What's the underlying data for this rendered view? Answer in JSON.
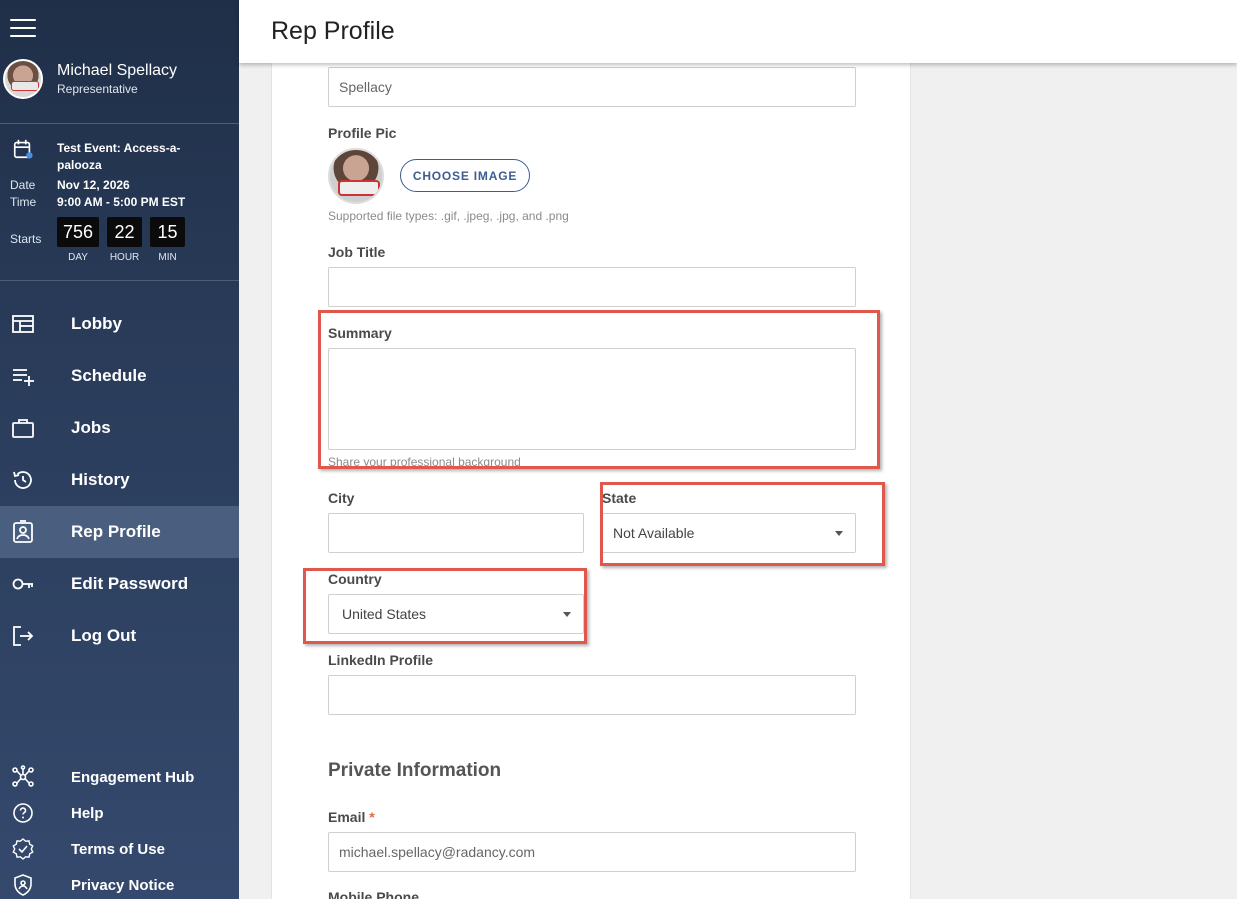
{
  "user": {
    "name": "Michael Spellacy",
    "role": "Representative"
  },
  "event": {
    "title": "Test Event: Access-a-palooza",
    "date_label": "Date",
    "date_value": "Nov 12, 2026",
    "time_label": "Time",
    "time_value": "9:00 AM - 5:00 PM EST",
    "starts_label": "Starts",
    "countdown": [
      {
        "value": "756",
        "unit": "DAY"
      },
      {
        "value": "22",
        "unit": "HOUR"
      },
      {
        "value": "15",
        "unit": "MIN"
      }
    ]
  },
  "nav": {
    "items": [
      {
        "label": "Lobby",
        "icon": "lobby-icon"
      },
      {
        "label": "Schedule",
        "icon": "schedule-icon"
      },
      {
        "label": "Jobs",
        "icon": "briefcase-icon"
      },
      {
        "label": "History",
        "icon": "history-icon"
      },
      {
        "label": "Rep Profile",
        "icon": "profile-icon",
        "active": true
      },
      {
        "label": "Edit Password",
        "icon": "key-icon"
      },
      {
        "label": "Log Out",
        "icon": "logout-icon"
      }
    ],
    "bottom": [
      {
        "label": "Engagement Hub",
        "icon": "hub-icon"
      },
      {
        "label": "Help",
        "icon": "help-icon"
      },
      {
        "label": "Terms of Use",
        "icon": "terms-icon"
      },
      {
        "label": "Privacy Notice",
        "icon": "privacy-icon"
      }
    ]
  },
  "header": {
    "title": "Rep Profile"
  },
  "form": {
    "last_name_value": "Spellacy",
    "profile_pic_label": "Profile Pic",
    "choose_image_label": "CHOOSE IMAGE",
    "file_types_hint": "Supported file types: .gif, .jpeg, .jpg, and .png",
    "job_title_label": "Job Title",
    "job_title_value": "",
    "summary_label": "Summary",
    "summary_value": "",
    "summary_hint": "Share your professional background",
    "city_label": "City",
    "city_value": "",
    "state_label": "State",
    "state_value": "Not Available",
    "country_label": "Country",
    "country_value": "United States",
    "linkedin_label": "LinkedIn Profile",
    "linkedin_value": "",
    "private_section_title": "Private Information",
    "email_label": "Email",
    "email_required": "*",
    "email_value": "michael.spellacy@radancy.com",
    "mobile_label": "Mobile Phone"
  },
  "colors": {
    "sidebar": "#2a3c5a",
    "accent": "#3d5d91",
    "highlight": "#e0574b"
  }
}
